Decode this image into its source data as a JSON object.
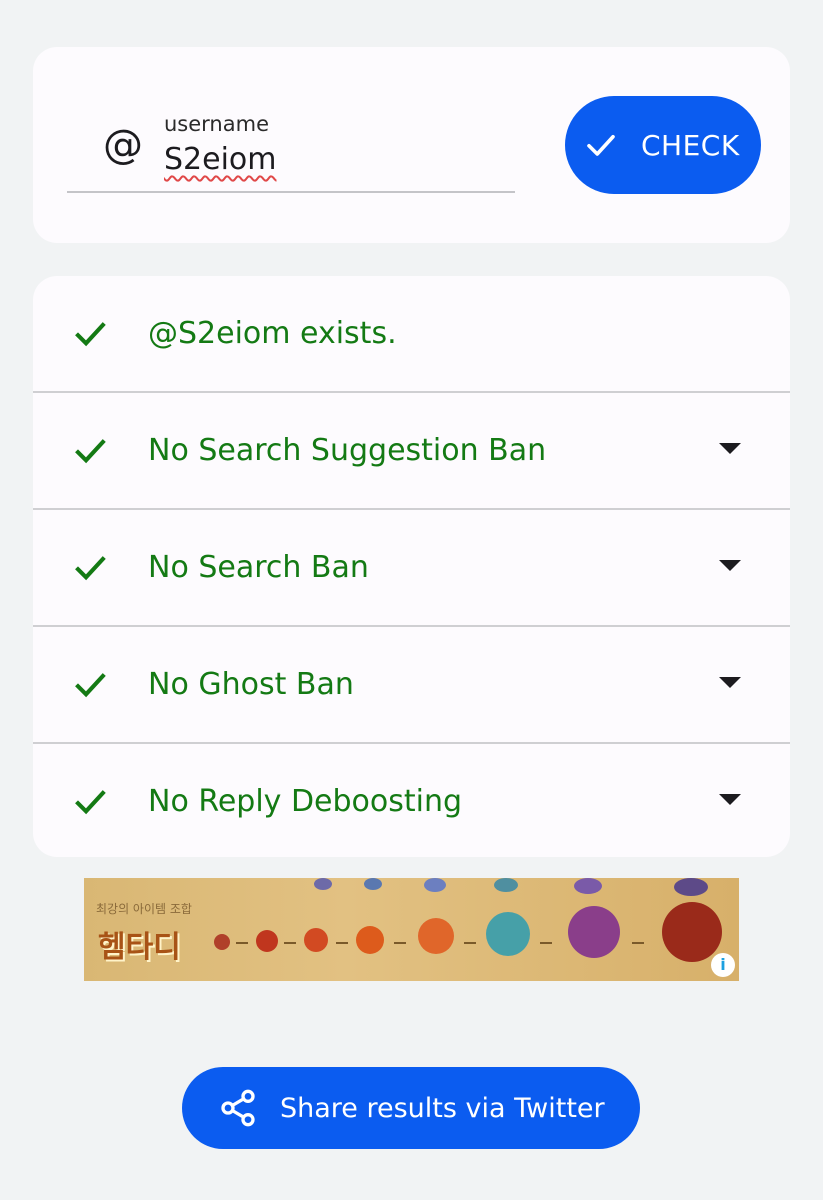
{
  "input": {
    "label": "username",
    "value": "S2eiom",
    "prefix_icon": "at-icon"
  },
  "check_button": {
    "label": "CHECK",
    "icon": "check-icon",
    "color": "#0b5cf0"
  },
  "results": [
    {
      "text": "@S2eiom exists.",
      "status": "ok",
      "expandable": false
    },
    {
      "text": "No Search Suggestion Ban",
      "status": "ok",
      "expandable": true
    },
    {
      "text": "No Search Ban",
      "status": "ok",
      "expandable": true
    },
    {
      "text": "No Ghost Ban",
      "status": "ok",
      "expandable": true
    },
    {
      "text": "No Reply Deboosting",
      "status": "ok",
      "expandable": true
    }
  ],
  "result_color": "#147a14",
  "ad": {
    "title": "헴타디",
    "subtitle": "최강의 아이템 조합",
    "info_icon": "ad-info-icon"
  },
  "share_button": {
    "label": "Share results via Twitter",
    "icon": "share-icon"
  }
}
